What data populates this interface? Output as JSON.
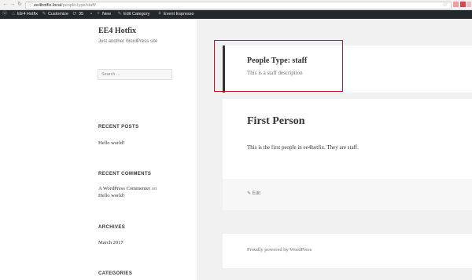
{
  "browser": {
    "url_host": "ee4hotfix.local",
    "url_path": "/people-type/staff/"
  },
  "admin_bar": {
    "site_name": "EE4 Hotfix",
    "customize": "Customize",
    "updates_count": "35",
    "new": "New",
    "edit_category": "Edit Category",
    "event_espresso": "Event Espresso"
  },
  "sidebar": {
    "site_title": "EE4 Hotfix",
    "site_description": "Just another WordPress site",
    "search_placeholder": "Search ...",
    "recent_posts_title": "RECENT POSTS",
    "recent_posts": [
      "Hello world!"
    ],
    "recent_comments_title": "RECENT COMMENTS",
    "comment_author": "A WordPress Commenter",
    "comment_on": "on",
    "comment_post": "Hello world!",
    "archives_title": "ARCHIVES",
    "archives": [
      "March 2017"
    ],
    "categories_title": "CATEGORIES"
  },
  "archive_header": {
    "title": "People Type: staff",
    "description": "This is a staff description"
  },
  "post": {
    "title": "First Person",
    "body": "This is the first people in ee4hotfix. They are staff.",
    "edit_label": "Edit"
  },
  "footer": {
    "credit": "Proudly powered by WordPress"
  }
}
